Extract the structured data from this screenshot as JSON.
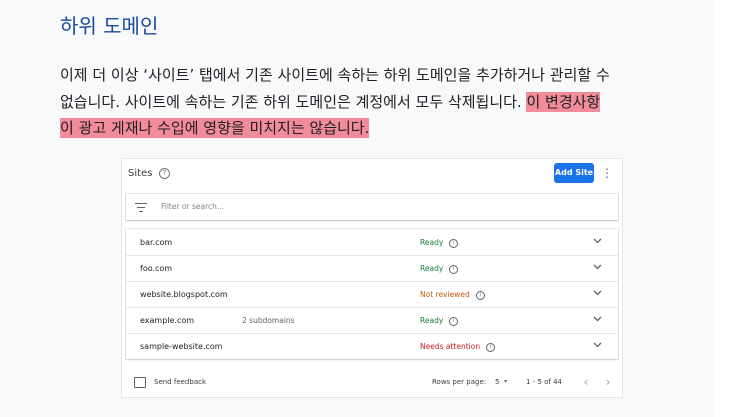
{
  "section": {
    "title": "하위 도메인",
    "para_line1": "이제 더 이상 ‘사이트’ 탭에서 기존 사이트에 속하는 하위 도메인을 추가하거나 관리할 수",
    "para_line2_plain": "없습니다. 사이트에 속하는 기존 하위 도메인은 계정에서 모두 삭제됩니다.",
    "para_line2_highlight": "이 변경사항",
    "para_line3_highlight": "이 광고 게재나 수입에 영향을 미치지는 않습니다.",
    "highlight_color": "#f28b9a"
  },
  "sites_panel": {
    "title": "Sites",
    "help_icon": "help-circle-icon",
    "add_button": "Add Site",
    "more_icon": "more-vert-icon",
    "filter_placeholder": "Filter or search...",
    "rows": [
      {
        "site": "bar.com",
        "subdomains": "",
        "status": "Ready",
        "status_color": "#188038"
      },
      {
        "site": "foo.com",
        "subdomains": "",
        "status": "Ready",
        "status_color": "#188038"
      },
      {
        "site": "website.blogspot.com",
        "subdomains": "",
        "status": "Not reviewed",
        "status_color": "#c5590d"
      },
      {
        "site": "example.com",
        "subdomains": "2 subdomains",
        "status": "Ready",
        "status_color": "#188038"
      },
      {
        "site": "sample-website.com",
        "subdomains": "",
        "status": "Needs attention",
        "status_color": "#c5221f"
      }
    ],
    "footer": {
      "feedback": "Send feedback",
      "rows_per_page_label": "Rows per page:",
      "rows_per_page_value": "5",
      "range": "1 - 5 of 44"
    },
    "accent_color": "#1a73e8"
  }
}
